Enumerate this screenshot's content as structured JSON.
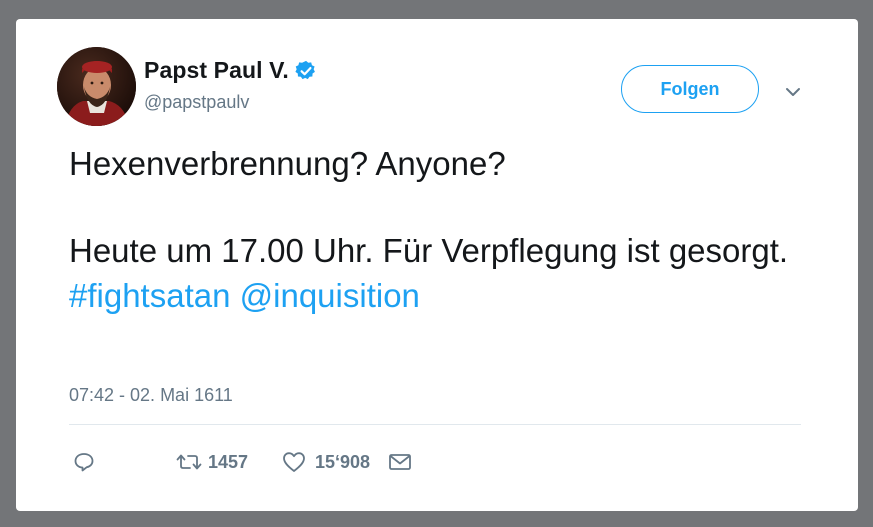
{
  "tweet": {
    "author": {
      "display_name": "Papst Paul V.",
      "handle": "@papstpaulv",
      "verified": true,
      "avatar_icon": "portrait-avatar"
    },
    "follow_label": "Folgen",
    "text": {
      "line1": "Hexenverbrennung? Anyone?",
      "line2_prefix": "Heute um 17.00 Uhr. Für Verpflegung ist gesorgt. ",
      "hashtag": "#fightsatan",
      "mention": "@inquisition"
    },
    "timestamp": "07:42 - 02. Mai 1611",
    "actions": {
      "reply_icon": "reply-icon",
      "retweet_count": "1457",
      "like_count": "15‘908",
      "dm_icon": "envelope-icon"
    }
  },
  "colors": {
    "accent": "#1da1f2",
    "text_primary": "#14171a",
    "text_secondary": "#657786",
    "background": "#737578",
    "card": "#ffffff"
  }
}
